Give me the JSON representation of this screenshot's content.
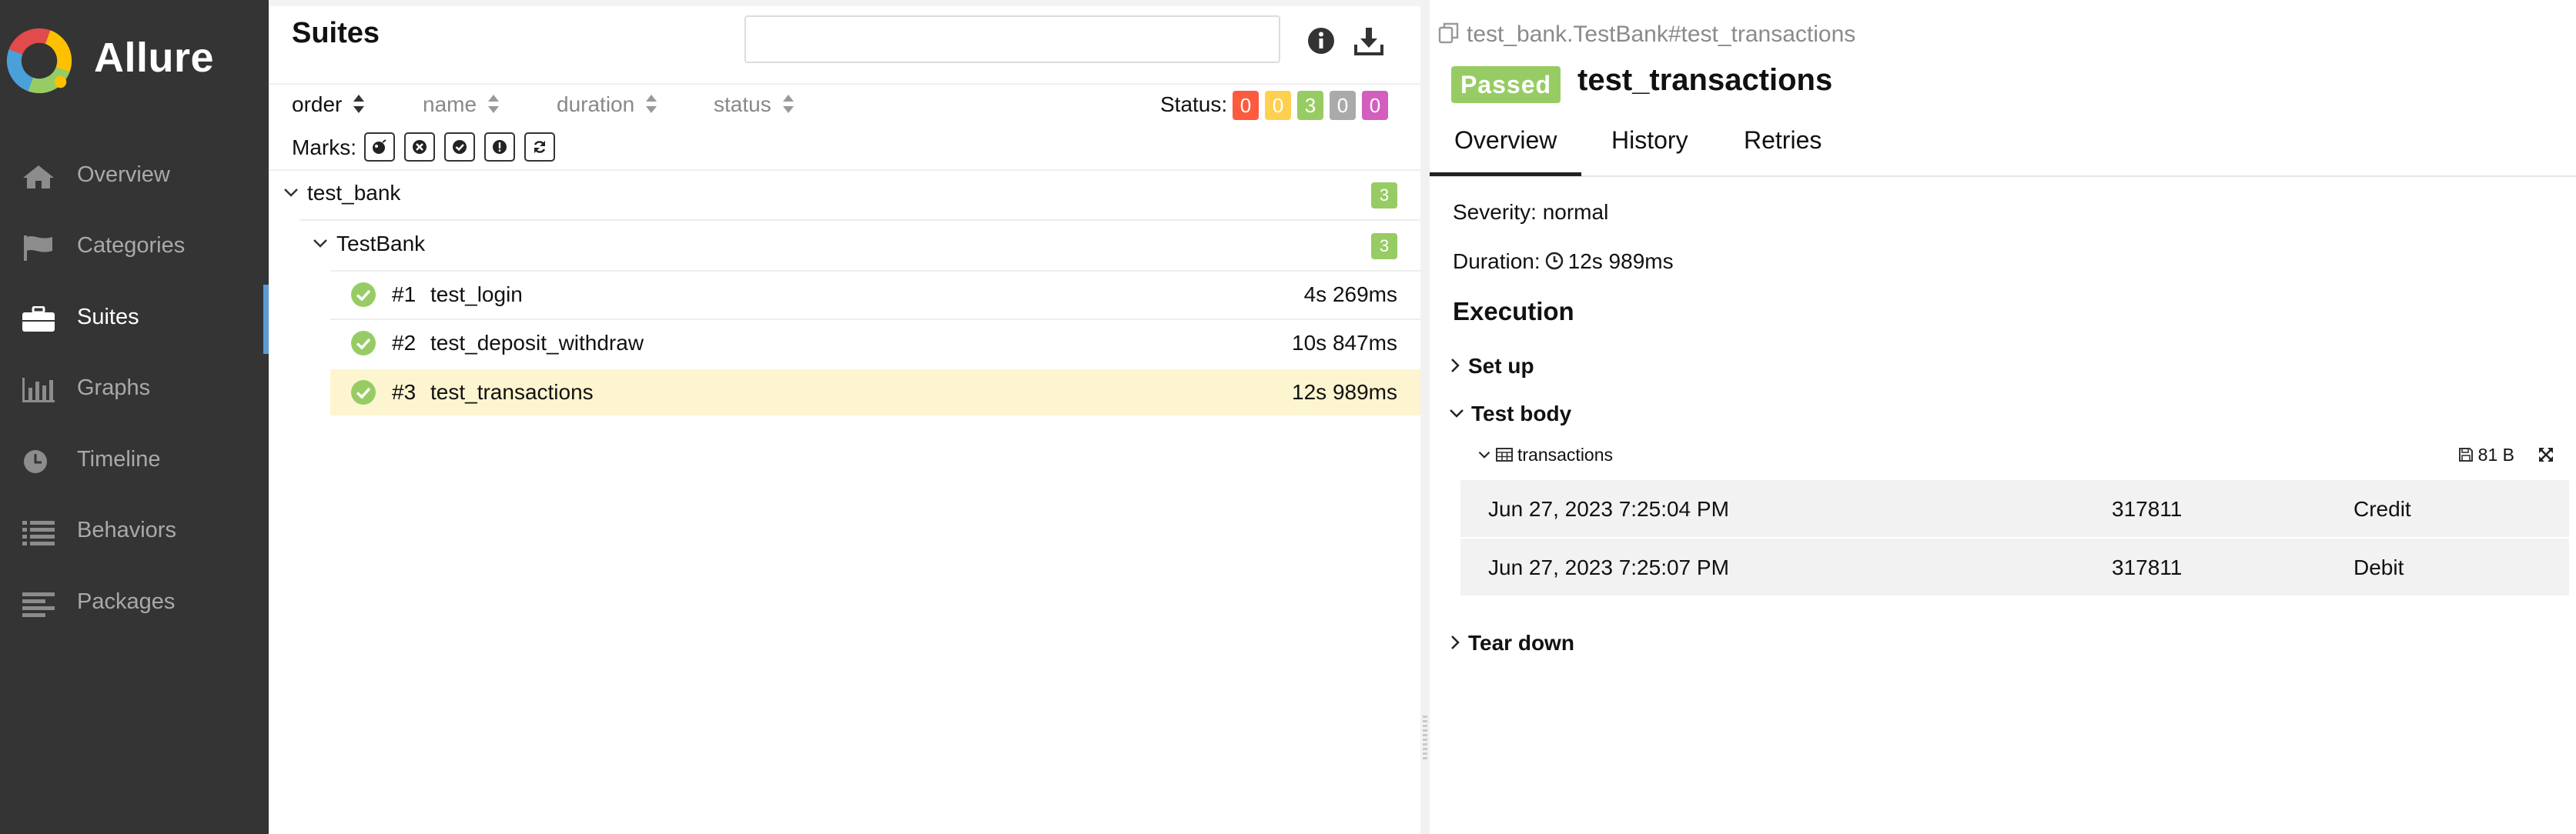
{
  "app": {
    "name": "Allure"
  },
  "sidebar": {
    "items": [
      {
        "label": "Overview",
        "icon": "home-icon"
      },
      {
        "label": "Categories",
        "icon": "flag-icon"
      },
      {
        "label": "Suites",
        "icon": "briefcase-icon",
        "active": true
      },
      {
        "label": "Graphs",
        "icon": "bar-chart-icon"
      },
      {
        "label": "Timeline",
        "icon": "clock-icon"
      },
      {
        "label": "Behaviors",
        "icon": "list-icon"
      },
      {
        "label": "Packages",
        "icon": "align-left-icon"
      }
    ]
  },
  "suites": {
    "title": "Suites",
    "search": {
      "value": "",
      "placeholder": ""
    },
    "sort": {
      "order": "order",
      "name": "name",
      "duration": "duration",
      "status": "status"
    },
    "status_label": "Status:",
    "status_counts": [
      {
        "status": "failed",
        "count": "0",
        "color": "#fd5a3e"
      },
      {
        "status": "broken",
        "count": "0",
        "color": "#ffd050"
      },
      {
        "status": "passed",
        "count": "3",
        "color": "#97cc64"
      },
      {
        "status": "skipped",
        "count": "0",
        "color": "#aaaaaa"
      },
      {
        "status": "unknown",
        "count": "0",
        "color": "#d35ebe"
      }
    ],
    "marks_label": "Marks:",
    "marks": [
      "flaky-icon",
      "new-failed-icon",
      "new-passed-icon",
      "new-broken-icon",
      "retries-status-change-icon"
    ],
    "tree": {
      "suite": {
        "name": "test_bank",
        "count": "3"
      },
      "class": {
        "name": "TestBank",
        "count": "3"
      },
      "tests": [
        {
          "num": "#1",
          "name": "test_login",
          "duration": "4s 269ms"
        },
        {
          "num": "#2",
          "name": "test_deposit_withdraw",
          "duration": "10s 847ms"
        },
        {
          "num": "#3",
          "name": "test_transactions",
          "duration": "12s 989ms",
          "selected": true
        }
      ]
    }
  },
  "details": {
    "breadcrumb": "test_bank.TestBank#test_transactions",
    "status_badge": "Passed",
    "title": "test_transactions",
    "tabs": [
      "Overview",
      "History",
      "Retries"
    ],
    "severity": "Severity: normal",
    "duration_label": "Duration:",
    "duration_value": "12s 989ms",
    "execution_title": "Execution",
    "steps": {
      "setup": "Set up",
      "body": "Test body",
      "teardown": "Tear down"
    },
    "attachment": {
      "name": "transactions",
      "size": "81 B",
      "rows": [
        [
          "Jun 27, 2023 7:25:04 PM",
          "317811",
          "Credit"
        ],
        [
          "Jun 27, 2023 7:25:07 PM",
          "317811",
          "Debit"
        ]
      ]
    }
  },
  "colors": {
    "sidebar_bg": "#343434",
    "passed": "#97cc64",
    "selected_row": "#fdf5cf",
    "active_accent": "#5a9bd5"
  }
}
